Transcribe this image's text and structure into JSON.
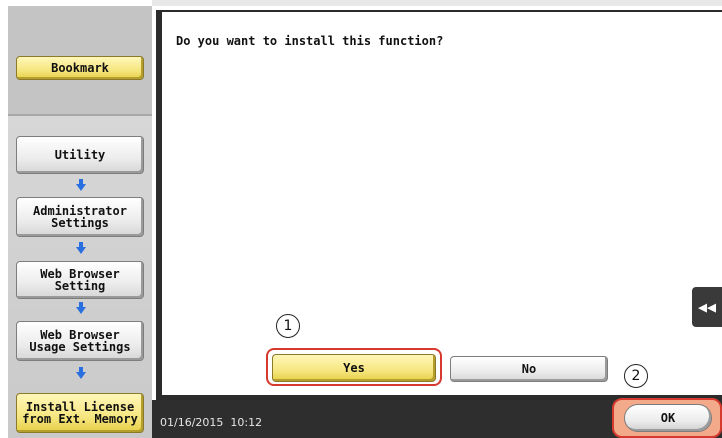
{
  "sidebar": {
    "bookmark": "Bookmark",
    "steps": [
      "Utility",
      "Administrator\nSettings",
      "Web Browser\nSetting",
      "Web Browser\nUsage Settings",
      "Install License\nfrom Ext. Memory"
    ]
  },
  "dialog": {
    "prompt": "Do you want to install this function?",
    "yes_label": "Yes",
    "no_label": "No"
  },
  "status": {
    "datetime": "01/16/2015  10:12",
    "ok_label": "OK"
  },
  "side_tab": {
    "glyph": "◀◀"
  },
  "callouts": {
    "one": "1",
    "two": "2"
  },
  "colors": {
    "highlight_yellow": "#f6e680",
    "callout_red": "#d63a2e",
    "arrow_blue": "#2a6fe0",
    "status_bar": "#2e2e2e"
  }
}
